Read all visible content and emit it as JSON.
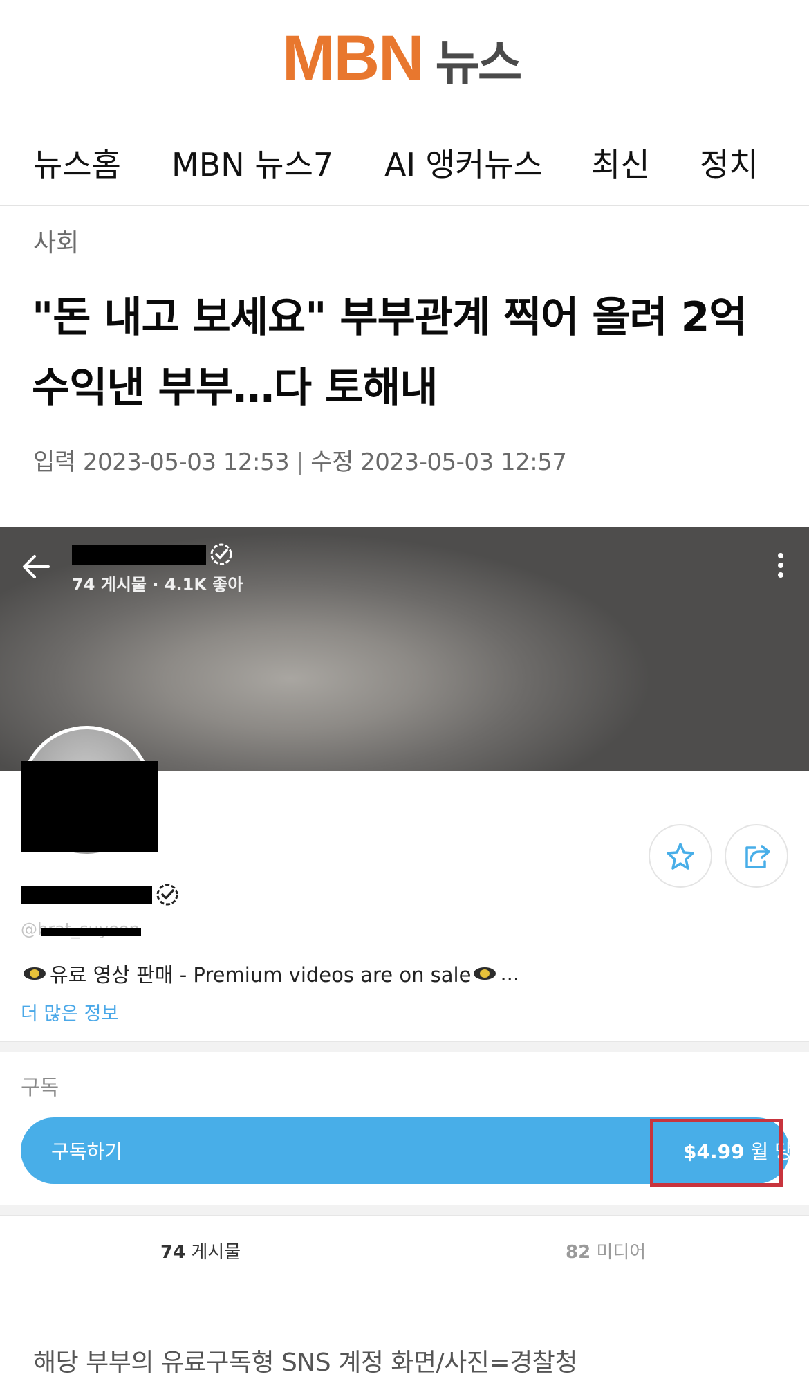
{
  "header": {
    "logo_brand": "MBN",
    "logo_suffix": "뉴스",
    "brand_color": "#e8772e"
  },
  "nav": {
    "items": [
      "뉴스홈",
      "MBN 뉴스7",
      "AI 앵커뉴스",
      "최신",
      "정치"
    ]
  },
  "article": {
    "category": "사회",
    "headline_line1": "\"돈 내고 보세요\" 부부관계 찍어 올려 2억",
    "headline_line2": "수익낸 부부…다 토해내",
    "published": "입력 2023-05-03 12:53",
    "separator": "|",
    "modified": "수정 2023-05-03 12:57",
    "caption": "해당 부부의 유료구독형 SNS 계정 화면/사진=경찰청"
  },
  "embedded": {
    "cover_stats": "74 게시물 · 4.1K 좋아",
    "handle": "@brat_suyeon",
    "bio": "유료 영상 판매 - Premium videos are on sale",
    "bio_ellipsis": "...",
    "more_info": "더 많은 정보",
    "subscription_label": "구독",
    "subscribe_button": "구독하기",
    "price": "$4.99",
    "price_unit": "월 당",
    "tab_posts_count": "74",
    "tab_posts_label": "게시물",
    "tab_media_count": "82",
    "tab_media_label": "미디어",
    "accent_color": "#48aee8",
    "highlight_color": "#c8343d",
    "icons": [
      "back-arrow-icon",
      "verified-icon",
      "kebab-menu-icon",
      "star-icon",
      "share-icon"
    ]
  }
}
